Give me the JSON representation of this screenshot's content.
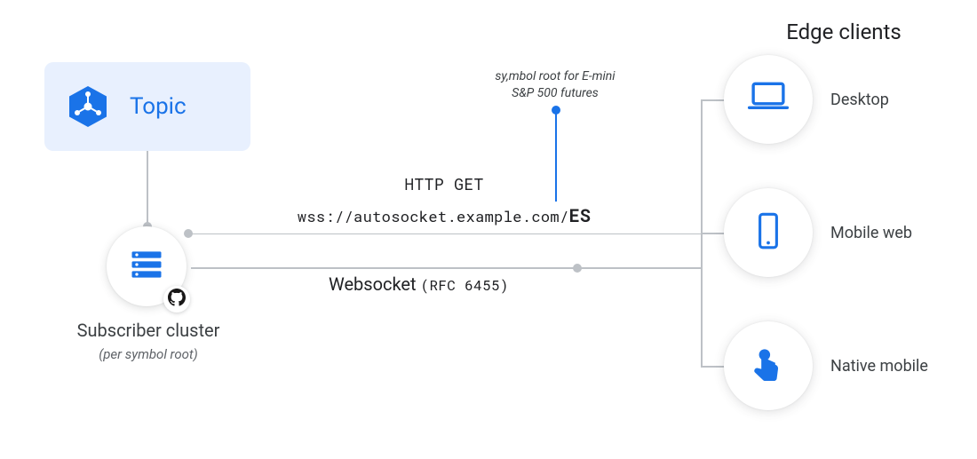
{
  "topic": {
    "label": "Topic"
  },
  "subscriber": {
    "title": "Subscriber cluster",
    "subtitle": "(per symbol root)"
  },
  "http": {
    "method": "HTTP GET",
    "url_prefix": "wss://autosocket.example.com/",
    "url_suffix": "ES"
  },
  "annotation": {
    "line1": "sy,mbol root for E-mini",
    "line2": "S&P 500 futures"
  },
  "websocket": {
    "label": "Websocket ",
    "rfc": "(RFC 6455)"
  },
  "edge": {
    "title": "Edge clients",
    "clients": [
      {
        "label": "Desktop"
      },
      {
        "label": "Mobile web"
      },
      {
        "label": "Native mobile"
      }
    ]
  },
  "colors": {
    "accent": "#1a73e8"
  }
}
